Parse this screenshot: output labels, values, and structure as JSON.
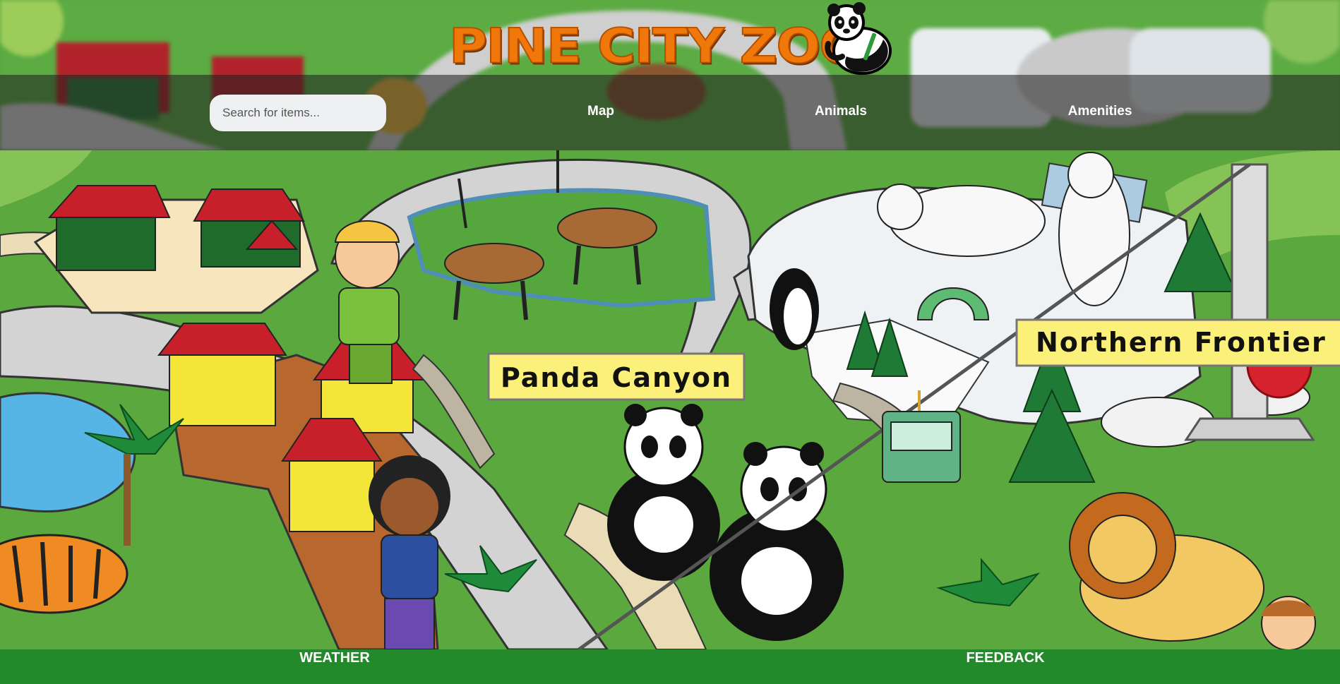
{
  "header": {
    "logo_text": "PINE CITY ZOO",
    "search": {
      "placeholder": "Search for items...",
      "value": ""
    },
    "nav": [
      {
        "label": "Map"
      },
      {
        "label": "Animals"
      },
      {
        "label": "Amenities"
      }
    ]
  },
  "map": {
    "signs": [
      {
        "label": "Panda Canyon"
      },
      {
        "label": "Northern Frontier"
      }
    ]
  },
  "footer": {
    "links": [
      {
        "label": "WEATHER"
      },
      {
        "label": "FEEDBACK"
      }
    ]
  },
  "colors": {
    "logo_orange": "#f0780a",
    "footer_green": "#24892a",
    "grass_green": "#5aa83e",
    "sign_yellow": "#fbf07a"
  }
}
